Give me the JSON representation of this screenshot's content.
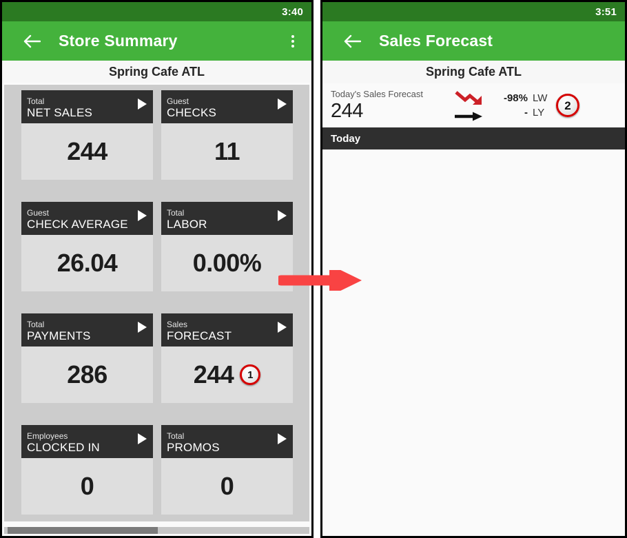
{
  "left_phone": {
    "status_bar": {
      "clock": "3:40"
    },
    "app_bar": {
      "back_icon": "arrow-left-icon",
      "title": "Store Summary",
      "overflow_icon": "more-vertical-icon"
    },
    "store_name": "Spring Cafe ATL",
    "tiles": [
      {
        "category": "Total",
        "metric": "NET SALES",
        "value": "244",
        "badge": null
      },
      {
        "category": "Guest",
        "metric": "CHECKS",
        "value": "11",
        "badge": null
      },
      {
        "category": "Guest",
        "metric": "CHECK AVERAGE",
        "value": "26.04",
        "badge": null
      },
      {
        "category": "Total",
        "metric": "LABOR",
        "value": "0.00%",
        "badge": null
      },
      {
        "category": "Total",
        "metric": "PAYMENTS",
        "value": "286",
        "badge": null
      },
      {
        "category": "Sales",
        "metric": "FORECAST",
        "value": "244",
        "badge": "1"
      },
      {
        "category": "Employees",
        "metric": "CLOCKED IN",
        "value": "0",
        "badge": null
      },
      {
        "category": "Total",
        "metric": "PROMOS",
        "value": "0",
        "badge": null
      }
    ],
    "scrollbar": {
      "name": "horizontal-scrollbar"
    }
  },
  "right_phone": {
    "status_bar": {
      "clock": "3:51"
    },
    "app_bar": {
      "back_icon": "arrow-left-icon",
      "title": "Sales Forecast"
    },
    "store_name": "Spring Cafe ATL",
    "summary": {
      "caption": "Today's Sales Forecast",
      "value": "244",
      "trend_icon_primary": "trend-down-arrow-icon",
      "trend_icon_secondary": "trend-flat-arrow-icon",
      "comparisons": [
        {
          "pct": "-98%",
          "period": "LW"
        },
        {
          "pct": "-",
          "period": "LY"
        }
      ],
      "badge": "2"
    },
    "section_header": "Today",
    "list_items": []
  },
  "connector": {
    "icon": "right-arrow-annotation",
    "color": "#f94343"
  },
  "colors": {
    "status_bar_green": "#2b7a22",
    "app_bar_green": "#44b23c",
    "tile_header_dark": "#2f2f2f",
    "tile_body_gray": "#dedede",
    "grid_background": "#cccccc",
    "badge_red": "#d50000",
    "trend_down_red": "#cc2027",
    "annotation_red": "#f94343"
  }
}
